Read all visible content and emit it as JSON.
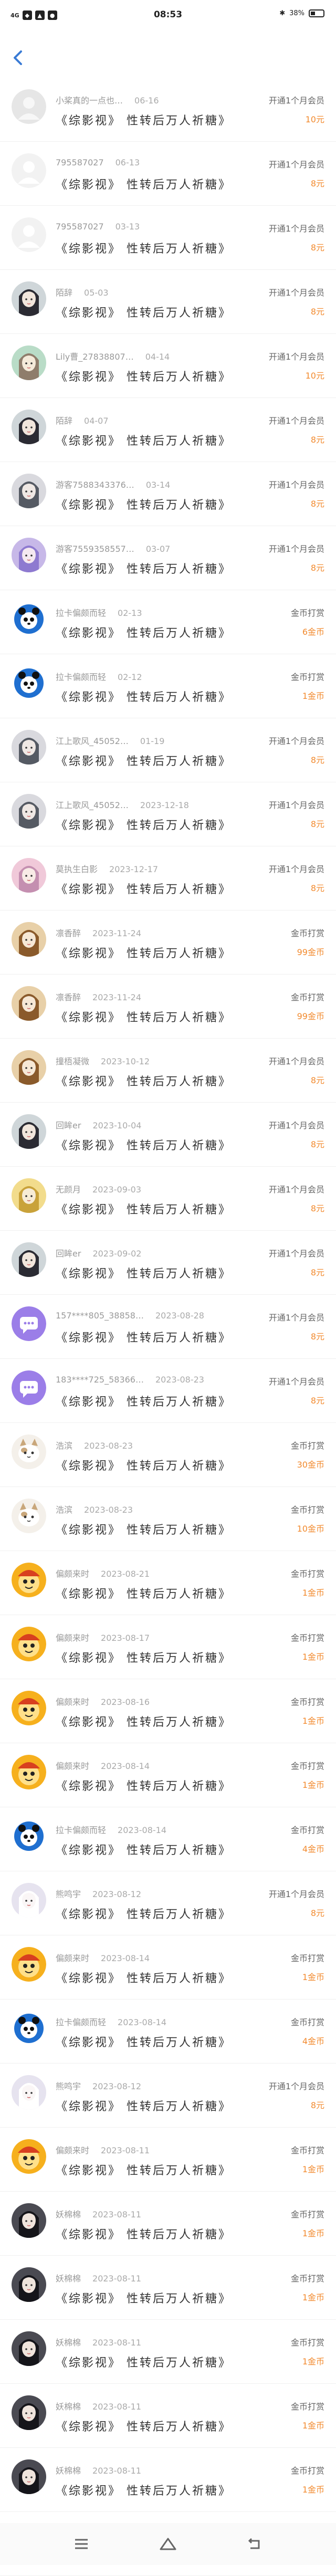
{
  "status": {
    "left_signal": "4G",
    "time": "08:53",
    "battery_percent": "38%"
  },
  "colors": {
    "accent": "#3a7bd5",
    "amount": "#f28a2e"
  },
  "records": [
    {
      "user": "小桨真的一点也…",
      "date": "06-16",
      "title": "《综影视》 性转后万人祈糖》",
      "type": "开通1个月会员",
      "amount": "10元",
      "avatar": "default"
    },
    {
      "user": "795587027",
      "date": "06-13",
      "title": "《综影视》 性转后万人祈糖》",
      "type": "开通1个月会员",
      "amount": "8元",
      "avatar": "gray"
    },
    {
      "user": "795587027",
      "date": "03-13",
      "title": "《综影视》 性转后万人祈糖》",
      "type": "开通1个月会员",
      "amount": "8元",
      "avatar": "gray"
    },
    {
      "user": "陌辞",
      "date": "05-03",
      "title": "《综影视》 性转后万人祈糖》",
      "type": "开通1个月会员",
      "amount": "8元",
      "avatar": "anime-dark"
    },
    {
      "user": "Lily曹_27838807…",
      "date": "04-14",
      "title": "《综影视》 性转后万人祈糖》",
      "type": "开通1个月会员",
      "amount": "10元",
      "avatar": "anime-green"
    },
    {
      "user": "陌辞",
      "date": "04-07",
      "title": "《综影视》 性转后万人祈糖》",
      "type": "开通1个月会员",
      "amount": "8元",
      "avatar": "anime-dark"
    },
    {
      "user": "游客7588343376…",
      "date": "03-14",
      "title": "《综影视》 性转后万人祈糖》",
      "type": "开通1个月会员",
      "amount": "8元",
      "avatar": "anime-gray"
    },
    {
      "user": "游客7559358557…",
      "date": "03-07",
      "title": "《综影视》 性转后万人祈糖》",
      "type": "开通1个月会员",
      "amount": "8元",
      "avatar": "anime-purple"
    },
    {
      "user": "拉卡偏颇而轻",
      "date": "02-13",
      "title": "《综影视》 性转后万人祈糖》",
      "type": "金币打赏",
      "amount": "6金币",
      "avatar": "panda"
    },
    {
      "user": "拉卡偏颇而轻",
      "date": "02-12",
      "title": "《综影视》 性转后万人祈糖》",
      "type": "金币打赏",
      "amount": "1金币",
      "avatar": "panda"
    },
    {
      "user": "江上歌风_45052…",
      "date": "01-19",
      "title": "《综影视》 性转后万人祈糖》",
      "type": "开通1个月会员",
      "amount": "8元",
      "avatar": "anime-gray"
    },
    {
      "user": "江上歌风_45052…",
      "date": "2023-12-18",
      "title": "《综影视》 性转后万人祈糖》",
      "type": "开通1个月会员",
      "amount": "8元",
      "avatar": "anime-gray"
    },
    {
      "user": "莫执生白影",
      "date": "2023-12-17",
      "title": "《综影视》 性转后万人祈糖》",
      "type": "开通1个月会员",
      "amount": "8元",
      "avatar": "anime-pink"
    },
    {
      "user": "凛香醉",
      "date": "2023-11-24",
      "title": "《综影视》 性转后万人祈糖》",
      "type": "金币打赏",
      "amount": "99金币",
      "avatar": "anime-brown"
    },
    {
      "user": "凛香醉",
      "date": "2023-11-24",
      "title": "《综影视》 性转后万人祈糖》",
      "type": "金币打赏",
      "amount": "99金币",
      "avatar": "anime-brown"
    },
    {
      "user": "撞梧凝微",
      "date": "2023-10-12",
      "title": "《综影视》 性转后万人祈糖》",
      "type": "开通1个月会员",
      "amount": "8元",
      "avatar": "anime-brown"
    },
    {
      "user": "回眸er",
      "date": "2023-10-04",
      "title": "《综影视》 性转后万人祈糖》",
      "type": "开通1个月会员",
      "amount": "8元",
      "avatar": "anime-dark"
    },
    {
      "user": "无颜月",
      "date": "2023-09-03",
      "title": "《综影视》 性转后万人祈糖》",
      "type": "开通1个月会员",
      "amount": "8元",
      "avatar": "anime-gold"
    },
    {
      "user": "回眸er",
      "date": "2023-09-02",
      "title": "《综影视》 性转后万人祈糖》",
      "type": "开通1个月会员",
      "amount": "8元",
      "avatar": "anime-dark"
    },
    {
      "user": "157****805_38858…",
      "date": "2023-08-28",
      "title": "《综影视》 性转后万人祈糖》",
      "type": "开通1个月会员",
      "amount": "8元",
      "avatar": "chat"
    },
    {
      "user": "183****725_58366…",
      "date": "2023-08-23",
      "title": "《综影视》 性转后万人祈糖》",
      "type": "开通1个月会员",
      "amount": "8元",
      "avatar": "chat"
    },
    {
      "user": "浩滨",
      "date": "2023-08-23",
      "title": "《综影视》 性转后万人祈糖》",
      "type": "金币打赏",
      "amount": "30金币",
      "avatar": "cat"
    },
    {
      "user": "浩滨",
      "date": "2023-08-23",
      "title": "《综影视》 性转后万人祈糖》",
      "type": "金币打赏",
      "amount": "10金币",
      "avatar": "cat"
    },
    {
      "user": "偏颇来时",
      "date": "2023-08-21",
      "title": "《综影视》 性转后万人祈糖》",
      "type": "金币打赏",
      "amount": "1金币",
      "avatar": "mascot"
    },
    {
      "user": "偏颇来时",
      "date": "2023-08-17",
      "title": "《综影视》 性转后万人祈糖》",
      "type": "金币打赏",
      "amount": "1金币",
      "avatar": "mascot"
    },
    {
      "user": "偏颇来时",
      "date": "2023-08-16",
      "title": "《综影视》 性转后万人祈糖》",
      "type": "金币打赏",
      "amount": "1金币",
      "avatar": "mascot"
    },
    {
      "user": "偏颇来时",
      "date": "2023-08-14",
      "title": "《综影视》 性转后万人祈糖》",
      "type": "金币打赏",
      "amount": "1金币",
      "avatar": "mascot"
    },
    {
      "user": "拉卡偏颇而轻",
      "date": "2023-08-14",
      "title": "《综影视》 性转后万人祈糖》",
      "type": "金币打赏",
      "amount": "4金币",
      "avatar": "panda"
    },
    {
      "user": "熊鸣宇",
      "date": "2023-08-12",
      "title": "《综影视》 性转后万人祈糖》",
      "type": "开通1个月会员",
      "amount": "8元",
      "avatar": "anime-white"
    },
    {
      "user": "偏颇来时",
      "date": "2023-08-14",
      "title": "《综影视》 性转后万人祈糖》",
      "type": "金币打赏",
      "amount": "1金币",
      "avatar": "mascot"
    },
    {
      "user": "拉卡偏颇而轻",
      "date": "2023-08-14",
      "title": "《综影视》 性转后万人祈糖》",
      "type": "金币打赏",
      "amount": "4金币",
      "avatar": "panda"
    },
    {
      "user": "熊鸣宇",
      "date": "2023-08-12",
      "title": "《综影视》 性转后万人祈糖》",
      "type": "开通1个月会员",
      "amount": "8元",
      "avatar": "anime-white"
    },
    {
      "user": "偏颇来时",
      "date": "2023-08-11",
      "title": "《综影视》 性转后万人祈糖》",
      "type": "金币打赏",
      "amount": "1金币",
      "avatar": "mascot"
    },
    {
      "user": "妖棉棉",
      "date": "2023-08-11",
      "title": "《综影视》 性转后万人祈糖》",
      "type": "金币打赏",
      "amount": "1金币",
      "avatar": "anime-black"
    },
    {
      "user": "妖棉棉",
      "date": "2023-08-11",
      "title": "《综影视》 性转后万人祈糖》",
      "type": "金币打赏",
      "amount": "1金币",
      "avatar": "anime-black"
    },
    {
      "user": "妖棉棉",
      "date": "2023-08-11",
      "title": "《综影视》 性转后万人祈糖》",
      "type": "金币打赏",
      "amount": "1金币",
      "avatar": "anime-black"
    },
    {
      "user": "妖棉棉",
      "date": "2023-08-11",
      "title": "《综影视》 性转后万人祈糖》",
      "type": "金币打赏",
      "amount": "1金币",
      "avatar": "anime-black"
    },
    {
      "user": "妖棉棉",
      "date": "2023-08-11",
      "title": "《综影视》 性转后万人祈糖》",
      "type": "金币打赏",
      "amount": "1金币",
      "avatar": "anime-black"
    },
    {
      "user": "妖棉棉",
      "date": "2023-08-11",
      "title": "《综影视》 性转后万人祈糖》",
      "type": "金币打赏",
      "amount": "1金币",
      "avatar": "anime-black"
    }
  ]
}
